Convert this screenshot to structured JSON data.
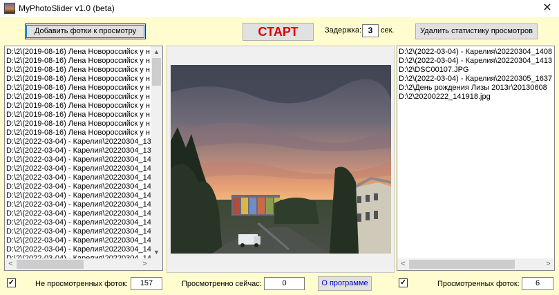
{
  "window": {
    "title": "MyPhotoSlider v1.0 (beta)",
    "close_glyph": "✕"
  },
  "toolbar": {
    "add_label": "Добавить фотки к просмотру",
    "start_label": "СТАРТ",
    "delay_label": "Задержка:",
    "delay_value": "3",
    "delay_unit": "сек.",
    "clear_stats_label": "Удалить статистику просмотров"
  },
  "left_list": {
    "items": [
      "D:\\2\\(2019-08-16) Лена Новороссийск у н",
      "D:\\2\\(2019-08-16) Лена Новороссийск у н",
      "D:\\2\\(2019-08-16) Лена Новороссийск у н",
      "D:\\2\\(2019-08-16) Лена Новороссийск у н",
      "D:\\2\\(2019-08-16) Лена Новороссийск у н",
      "D:\\2\\(2019-08-16) Лена Новороссийск у н",
      "D:\\2\\(2019-08-16) Лена Новороссийск у н",
      "D:\\2\\(2019-08-16) Лена Новороссийск у н",
      "D:\\2\\(2019-08-16) Лена Новороссийск у н",
      "D:\\2\\(2019-08-16) Лена Новороссийск у н",
      "D:\\2\\(2022-03-04) - Карелия\\20220304_13",
      "D:\\2\\(2022-03-04) - Карелия\\20220304_13",
      "D:\\2\\(2022-03-04) - Карелия\\20220304_14",
      "D:\\2\\(2022-03-04) - Карелия\\20220304_14",
      "D:\\2\\(2022-03-04) - Карелия\\20220304_14",
      "D:\\2\\(2022-03-04) - Карелия\\20220304_14",
      "D:\\2\\(2022-03-04) - Карелия\\20220304_14",
      "D:\\2\\(2022-03-04) - Карелия\\20220304_14",
      "D:\\2\\(2022-03-04) - Карелия\\20220304_14",
      "D:\\2\\(2022-03-04) - Карелия\\20220304_14",
      "D:\\2\\(2022-03-04) - Карелия\\20220304_14",
      "D:\\2\\(2022-03-04) - Карелия\\20220304_14",
      "D:\\2\\(2022-03-04) - Карелия\\20220304_14",
      "D:\\2\\(2022-03-04) - Карелия\\20220304_14",
      "D:\\2\\(2022-03-04) - Карелия\\20220304_14"
    ],
    "scroll_up": "▲",
    "scroll_down": "▼",
    "scroll_left": "<",
    "scroll_right": ">"
  },
  "right_list": {
    "items": [
      "D:\\2\\(2022-03-04) - Карелия\\20220304_1408",
      "D:\\2\\(2022-03-04) - Карелия\\20220304_1413",
      "D:\\2\\DSC00107.JPG",
      "D:\\2\\(2022-03-04) - Карелия\\20220305_1637",
      "D:\\2\\День рождения Лизы 2013г\\20130608",
      "D:\\2\\20200222_141918.jpg"
    ],
    "scroll_left": "<",
    "scroll_right": ">"
  },
  "status": {
    "unviewed_label": "Не просмотренных фоток:",
    "unviewed_value": "157",
    "viewed_now_label": "Просмотренно сейчас:",
    "viewed_now_value": "0",
    "about_label": "О программе",
    "viewed_label": "Просмотренных фоток:",
    "viewed_value": "6",
    "check_glyph": "✓"
  },
  "colors": {
    "client_bg": "#fffccf",
    "start_text": "#e00000",
    "about_text": "#0000c0"
  }
}
